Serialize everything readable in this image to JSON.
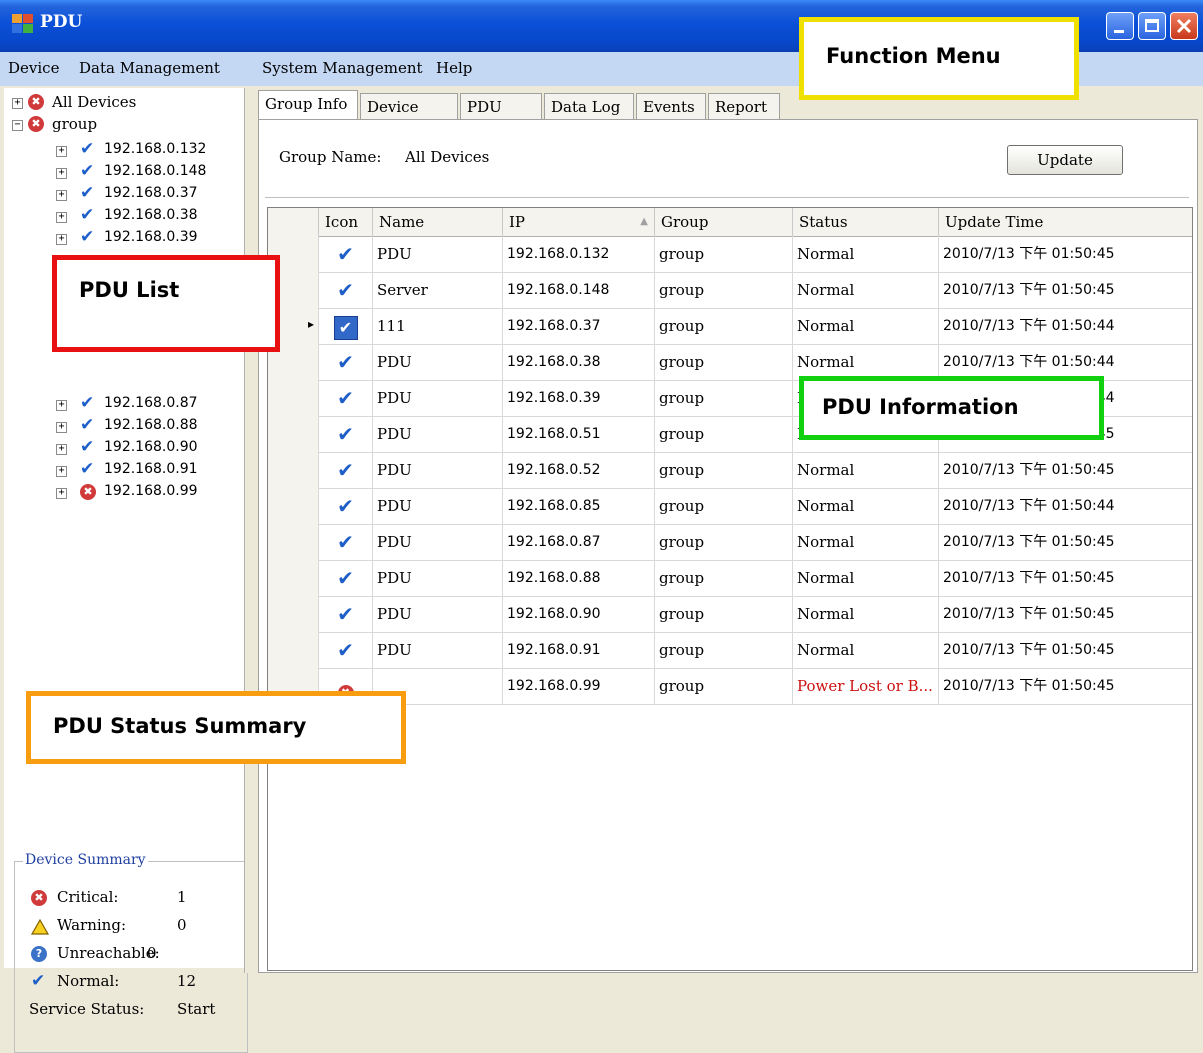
{
  "window": {
    "title": "PDU"
  },
  "menu": [
    "Device",
    "Data Management",
    "System Management",
    "Help"
  ],
  "tree": {
    "root": "All Devices",
    "group": "group",
    "devices": [
      {
        "ip": "192.168.0.132",
        "status": "normal"
      },
      {
        "ip": "192.168.0.148",
        "status": "normal"
      },
      {
        "ip": "192.168.0.37",
        "status": "normal"
      },
      {
        "ip": "192.168.0.38",
        "status": "normal"
      },
      {
        "ip": "192.168.0.39",
        "status": "normal"
      },
      {
        "ip": "192.168.0.87",
        "status": "normal"
      },
      {
        "ip": "192.168.0.88",
        "status": "normal"
      },
      {
        "ip": "192.168.0.90",
        "status": "normal"
      },
      {
        "ip": "192.168.0.91",
        "status": "normal"
      },
      {
        "ip": "192.168.0.99",
        "status": "critical"
      }
    ]
  },
  "summary": {
    "title": "Device Summary",
    "critical_label": "Critical:",
    "critical": "1",
    "warning_label": "Warning:",
    "warning": "0",
    "unreachable_label": "Unreachable:",
    "unreachable": "0",
    "normal_label": "Normal:",
    "normal": "12",
    "service_label": "Service Status:",
    "service": "Start"
  },
  "tabs": [
    "Group Info",
    "Device Info",
    "PDU Info",
    "Data Log",
    "Events",
    "Report"
  ],
  "group_info": {
    "name_label": "Group Name:",
    "name_value": "All Devices",
    "update_button": "Update"
  },
  "table": {
    "columns": [
      "Icon",
      "Name",
      "IP",
      "Group",
      "Status",
      "Update Time"
    ],
    "rows": [
      {
        "icon": "check-icon",
        "name": "PDU",
        "ip": "192.168.0.132",
        "group": "group",
        "status": "Normal",
        "time": "2010/7/13 下午 01:50:45"
      },
      {
        "icon": "check-icon",
        "name": "Server",
        "ip": "192.168.0.148",
        "group": "group",
        "status": "Normal",
        "time": "2010/7/13 下午 01:50:45"
      },
      {
        "icon": "check-icon",
        "name": "111",
        "ip": "192.168.0.37",
        "group": "group",
        "status": "Normal",
        "time": "2010/7/13 下午 01:50:44"
      },
      {
        "icon": "check-icon",
        "name": "PDU",
        "ip": "192.168.0.38",
        "group": "group",
        "status": "Normal",
        "time": "2010/7/13 下午 01:50:44"
      },
      {
        "icon": "check-icon",
        "name": "PDU",
        "ip": "192.168.0.39",
        "group": "group",
        "status": "Normal",
        "time": "2010/7/13 下午 01:50:44"
      },
      {
        "icon": "check-icon",
        "name": "PDU",
        "ip": "192.168.0.51",
        "group": "group",
        "status": "Normal",
        "time": "2010/7/13 下午 01:50:45"
      },
      {
        "icon": "check-icon",
        "name": "PDU",
        "ip": "192.168.0.52",
        "group": "group",
        "status": "Normal",
        "time": "2010/7/13 下午 01:50:45"
      },
      {
        "icon": "check-icon",
        "name": "PDU",
        "ip": "192.168.0.85",
        "group": "group",
        "status": "Normal",
        "time": "2010/7/13 下午 01:50:44"
      },
      {
        "icon": "check-icon",
        "name": "PDU",
        "ip": "192.168.0.87",
        "group": "group",
        "status": "Normal",
        "time": "2010/7/13 下午 01:50:45"
      },
      {
        "icon": "check-icon",
        "name": "PDU",
        "ip": "192.168.0.88",
        "group": "group",
        "status": "Normal",
        "time": "2010/7/13 下午 01:50:45"
      },
      {
        "icon": "check-icon",
        "name": "PDU",
        "ip": "192.168.0.90",
        "group": "group",
        "status": "Normal",
        "time": "2010/7/13 下午 01:50:45"
      },
      {
        "icon": "check-icon",
        "name": "PDU",
        "ip": "192.168.0.91",
        "group": "group",
        "status": "Normal",
        "time": "2010/7/13 下午 01:50:45"
      },
      {
        "icon": "critical-icon",
        "name": "",
        "ip": "192.168.0.99",
        "group": "group",
        "status": "Power Lost or B...",
        "time": "2010/7/13 下午 01:50:45"
      }
    ]
  },
  "annotations": {
    "function_menu": "Function Menu",
    "pdu_list": "PDU List",
    "pdu_info": "PDU Information",
    "status_summary": "PDU Status Summary"
  },
  "colors": {
    "critical_text": "#cc1010",
    "check": "#1e5ec8",
    "anno_yellow": "#f0e000",
    "anno_red": "#e81010",
    "anno_green": "#10d010",
    "anno_orange": "#f89c10"
  }
}
